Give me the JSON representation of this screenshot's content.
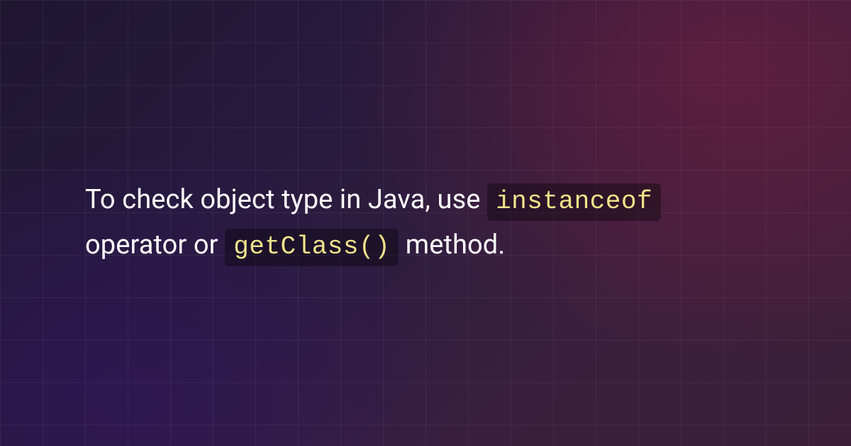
{
  "sentence": {
    "part1": "To check object type in Java, use ",
    "code1": "instanceof",
    "part2": " operator or ",
    "code2": "getClass()",
    "part3": " method."
  }
}
